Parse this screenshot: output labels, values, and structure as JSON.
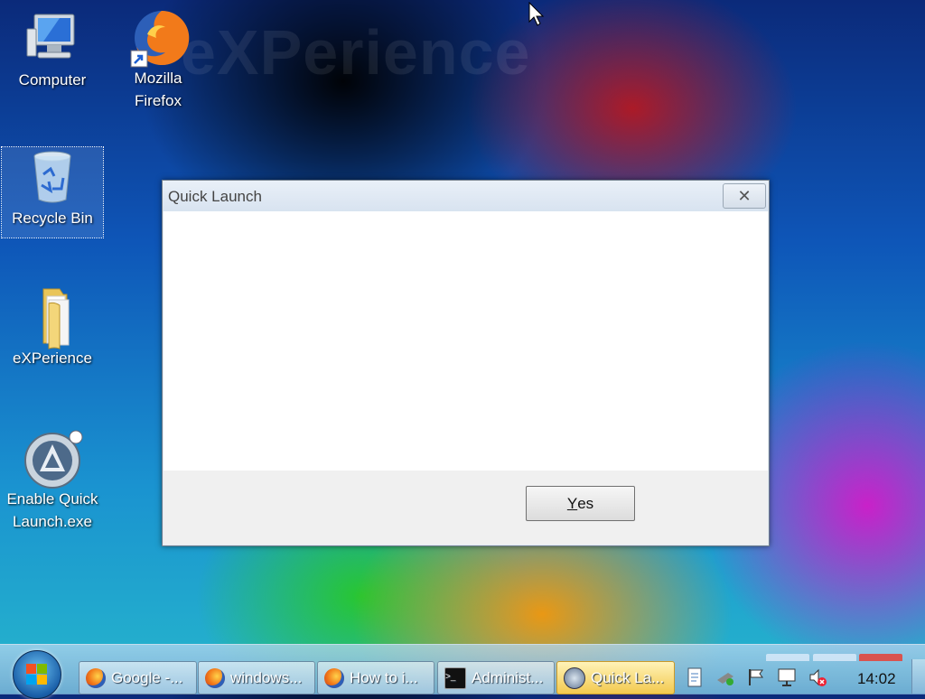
{
  "desktop": {
    "watermark": "eXPerience",
    "icons": [
      {
        "label": "Computer"
      },
      {
        "label": "Mozilla Firefox"
      },
      {
        "label": "Recycle Bin"
      },
      {
        "label": "eXPerience"
      },
      {
        "label": "Enable Quick Launch.exe"
      }
    ]
  },
  "dialog": {
    "title": "Quick Launch",
    "close_glyph": "✕",
    "yes_label": "Yes",
    "yes_accelerator": "Y",
    "yes_rest": "es"
  },
  "taskbar": {
    "buttons": [
      {
        "label": "Google -...",
        "icon": "firefox-icon"
      },
      {
        "label": "windows...",
        "icon": "firefox-icon"
      },
      {
        "label": "How to i...",
        "icon": "firefox-icon"
      },
      {
        "label": "Administ...",
        "icon": "command-prompt-icon"
      },
      {
        "label": "Quick La...",
        "icon": "quick-launch-icon",
        "active": true
      }
    ],
    "tray_icons": [
      "document-icon",
      "network-icon",
      "action-center-flag-icon",
      "network-monitor-icon",
      "volume-muted-icon"
    ],
    "clock": "14:02"
  }
}
